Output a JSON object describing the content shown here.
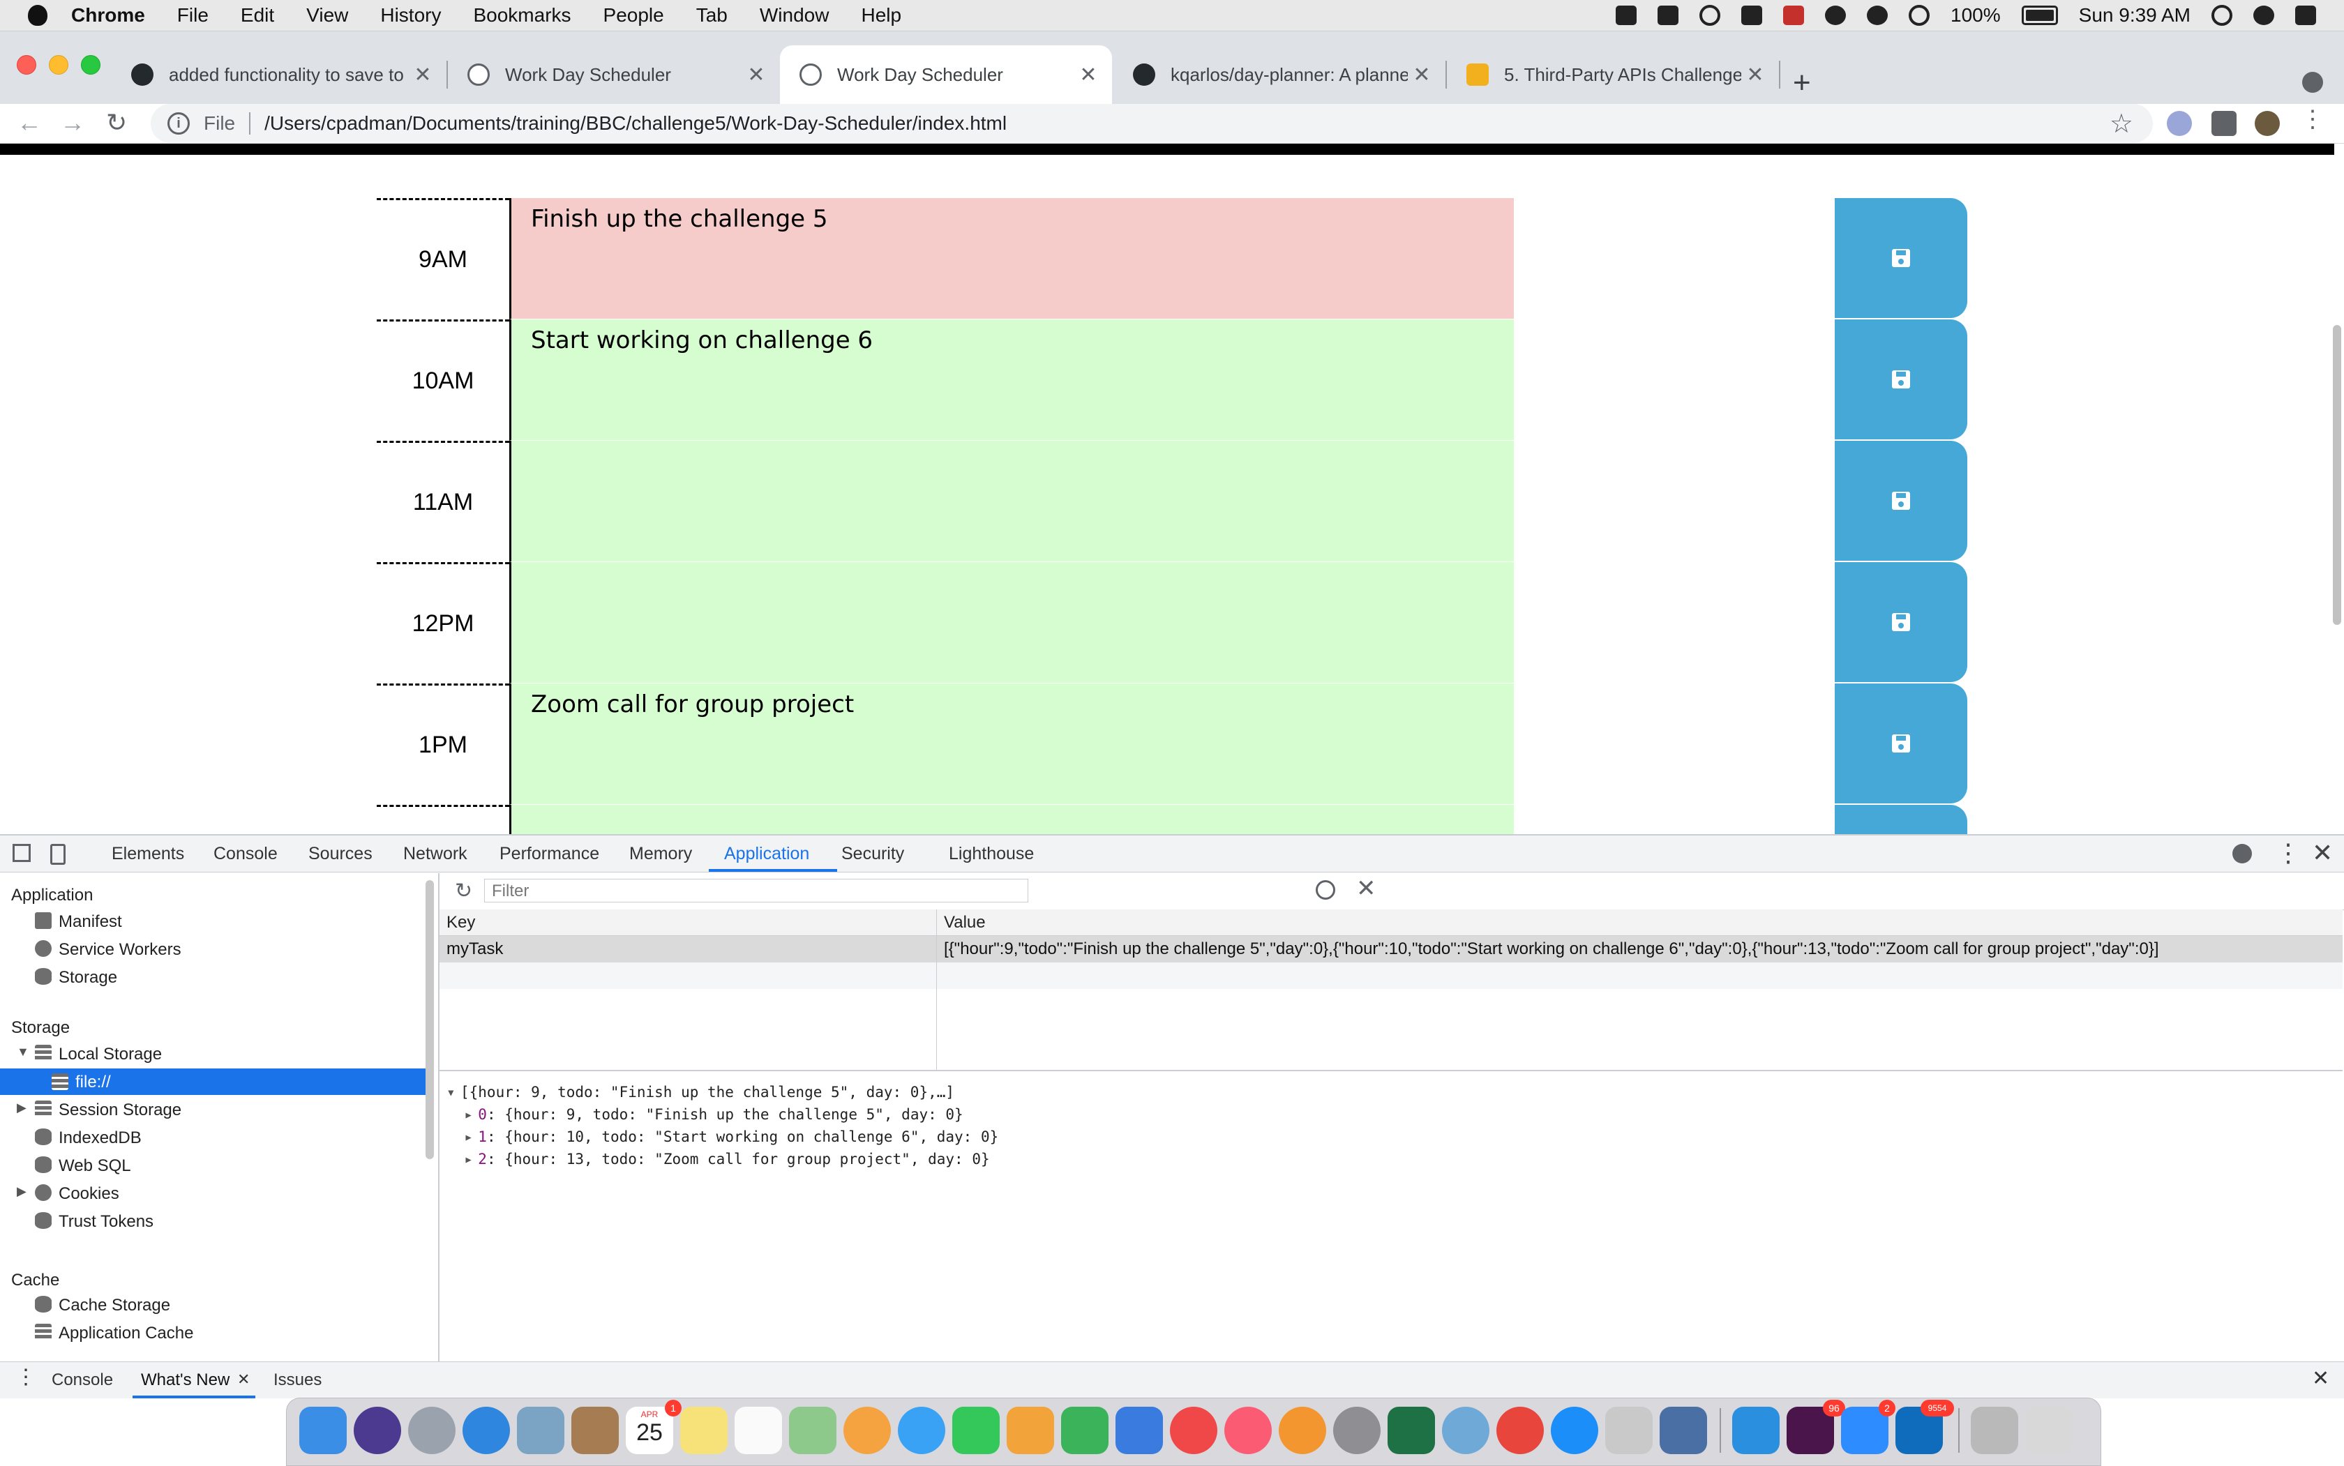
{
  "menubar": {
    "app": "Chrome",
    "items": [
      "File",
      "Edit",
      "View",
      "History",
      "Bookmarks",
      "People",
      "Tab",
      "Window",
      "Help"
    ],
    "battery": "100%",
    "clock": "Sun 9:39 AM"
  },
  "tabs": [
    {
      "title": "added functionality to save to",
      "favicon": "github-icon"
    },
    {
      "title": "Work Day Scheduler",
      "favicon": "globe-icon"
    },
    {
      "title": "Work Day Scheduler",
      "favicon": "globe-icon",
      "active": true
    },
    {
      "title": "kqarlos/day-planner: A planner",
      "favicon": "github-icon"
    },
    {
      "title": "5. Third-Party APIs Challenge:",
      "favicon": "course-icon"
    }
  ],
  "toolbar": {
    "scheme": "File",
    "url": "/Users/cpadman/Documents/training/BBC/challenge5/Work-Day-Scheduler/index.html"
  },
  "scheduler": {
    "rows": [
      {
        "hour": "9AM",
        "task": "Finish up the challenge 5",
        "state": "present"
      },
      {
        "hour": "10AM",
        "task": "Start working on challenge 6",
        "state": "future"
      },
      {
        "hour": "11AM",
        "task": "",
        "state": "future"
      },
      {
        "hour": "12PM",
        "task": "",
        "state": "future"
      },
      {
        "hour": "1PM",
        "task": "Zoom call for group project",
        "state": "future"
      }
    ],
    "colors": {
      "present": "#f6cccb",
      "future": "#d6fdd0",
      "save": "#46a8d6"
    }
  },
  "devtools": {
    "tabs": [
      "Elements",
      "Console",
      "Sources",
      "Network",
      "Performance",
      "Memory",
      "Application",
      "Security",
      "Lighthouse"
    ],
    "active_tab": "Application",
    "sidebar": {
      "application_header": "Application",
      "application_items": [
        "Manifest",
        "Service Workers",
        "Storage"
      ],
      "storage_header": "Storage",
      "storage_items": [
        "Local Storage",
        "file://",
        "Session Storage",
        "IndexedDB",
        "Web SQL",
        "Cookies",
        "Trust Tokens"
      ],
      "cache_header": "Cache",
      "cache_items": [
        "Cache Storage",
        "Application Cache"
      ]
    },
    "filter_placeholder": "Filter",
    "table": {
      "headers": {
        "key": "Key",
        "value": "Value"
      },
      "rows": [
        {
          "key": "myTask",
          "value": "[{\"hour\":9,\"todo\":\"Finish up the challenge 5\",\"day\":0},{\"hour\":10,\"todo\":\"Start working on challenge 6\",\"day\":0},{\"hour\":13,\"todo\":\"Zoom call for group project\",\"day\":0}]"
        }
      ]
    },
    "preview": {
      "summary": "[{hour: 9, todo: \"Finish up the challenge 5\", day: 0},…]",
      "items": [
        {
          "index": "0",
          "text": ": {hour: 9, todo: \"Finish up the challenge 5\", day: 0}"
        },
        {
          "index": "1",
          "text": ": {hour: 10, todo: \"Start working on challenge 6\", day: 0}"
        },
        {
          "index": "2",
          "text": ": {hour: 13, todo: \"Zoom call for group project\", day: 0}"
        }
      ]
    },
    "drawer": {
      "console": "Console",
      "whats_new": "What's New",
      "issues": "Issues"
    }
  },
  "dock": {
    "calendar_day": "25",
    "calendar_month": "APR",
    "badges": {
      "calendar": "1",
      "slack": "96",
      "zoom": "2",
      "outlook": "9554"
    }
  }
}
